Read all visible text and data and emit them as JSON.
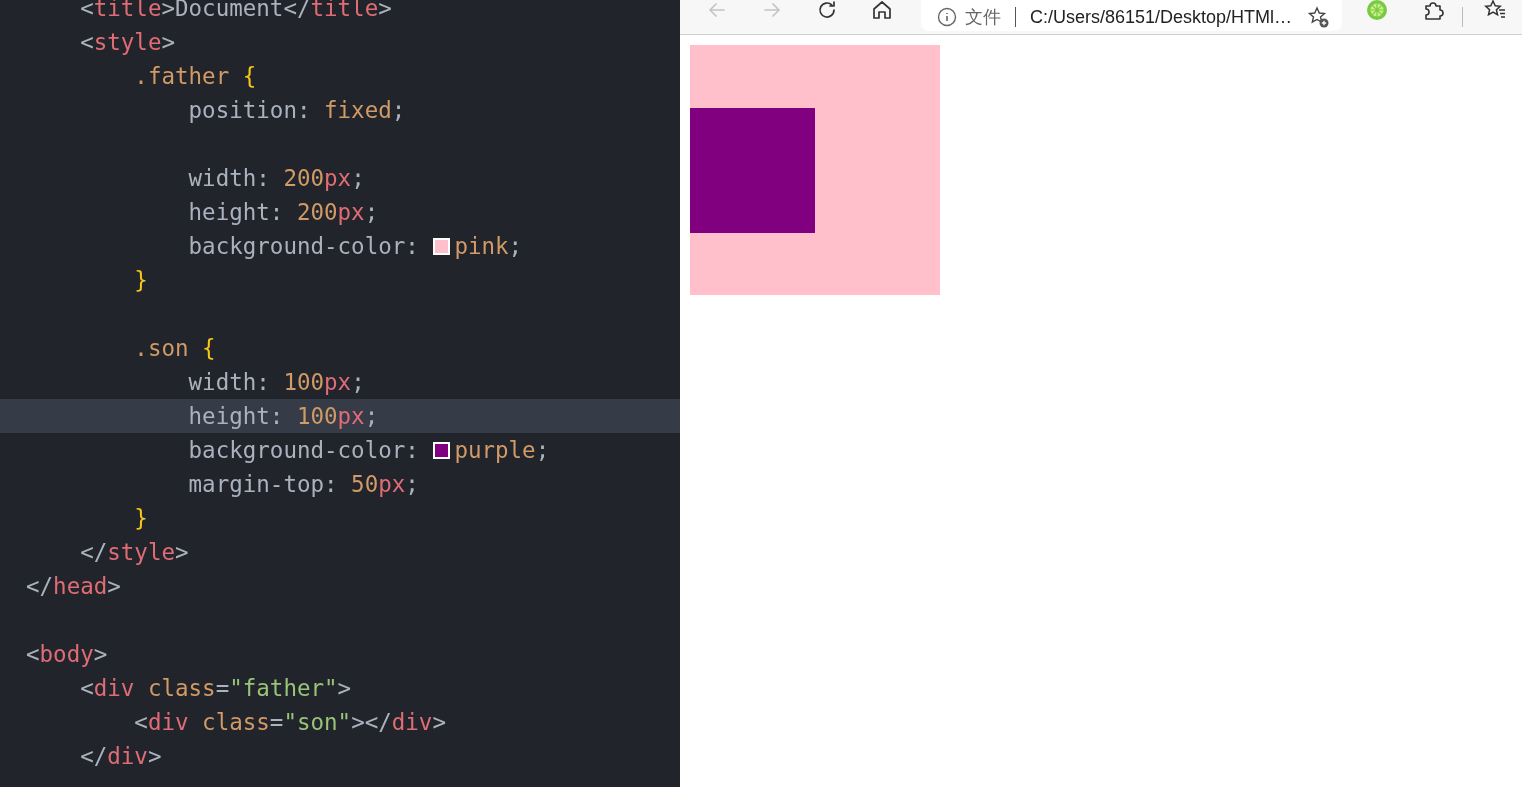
{
  "editor": {
    "lines": [
      {
        "current": false,
        "tokens": [
          {
            "kind": "punct",
            "text": "    <"
          },
          {
            "kind": "tag",
            "text": "title"
          },
          {
            "kind": "punct",
            "text": ">Document</"
          },
          {
            "kind": "tag",
            "text": "title"
          },
          {
            "kind": "punct",
            "text": ">"
          }
        ]
      },
      {
        "current": false,
        "tokens": [
          {
            "kind": "punct",
            "text": "    <"
          },
          {
            "kind": "tag",
            "text": "style"
          },
          {
            "kind": "punct",
            "text": ">"
          }
        ]
      },
      {
        "current": false,
        "tokens": [
          {
            "kind": "selector",
            "text": "        .father "
          },
          {
            "kind": "brace",
            "text": "{"
          }
        ]
      },
      {
        "current": false,
        "tokens": [
          {
            "kind": "prop",
            "text": "            position: "
          },
          {
            "kind": "number",
            "text": "fixed"
          },
          {
            "kind": "punct",
            "text": ";"
          }
        ]
      },
      {
        "current": false
      },
      {
        "current": false,
        "tokens": [
          {
            "kind": "prop",
            "text": "            width: "
          },
          {
            "kind": "number",
            "text": "200"
          },
          {
            "kind": "unit",
            "text": "px"
          },
          {
            "kind": "punct",
            "text": ";"
          }
        ]
      },
      {
        "current": false,
        "tokens": [
          {
            "kind": "prop",
            "text": "            height: "
          },
          {
            "kind": "number",
            "text": "200"
          },
          {
            "kind": "unit",
            "text": "px"
          },
          {
            "kind": "punct",
            "text": ";"
          }
        ]
      },
      {
        "current": false,
        "tokens": [
          {
            "kind": "prop",
            "text": "            background-color: "
          },
          {
            "kind": "swatch",
            "color": "#ffc0cb"
          },
          {
            "kind": "number",
            "text": "pink"
          },
          {
            "kind": "punct",
            "text": ";"
          }
        ]
      },
      {
        "current": false,
        "tokens": [
          {
            "kind": "brace",
            "text": "        }"
          }
        ]
      },
      {
        "current": false
      },
      {
        "current": false,
        "tokens": [
          {
            "kind": "selector",
            "text": "        .son "
          },
          {
            "kind": "brace",
            "text": "{"
          }
        ]
      },
      {
        "current": false,
        "tokens": [
          {
            "kind": "prop",
            "text": "            width: "
          },
          {
            "kind": "number",
            "text": "100"
          },
          {
            "kind": "unit",
            "text": "px"
          },
          {
            "kind": "punct",
            "text": ";"
          }
        ]
      },
      {
        "current": true,
        "tokens": [
          {
            "kind": "prop",
            "text": "            height: "
          },
          {
            "kind": "number",
            "text": "100"
          },
          {
            "kind": "unit",
            "text": "px"
          },
          {
            "kind": "punct",
            "text": ";"
          }
        ]
      },
      {
        "current": false,
        "tokens": [
          {
            "kind": "prop",
            "text": "            background-color: "
          },
          {
            "kind": "swatch",
            "color": "#800080"
          },
          {
            "kind": "number",
            "text": "purple"
          },
          {
            "kind": "punct",
            "text": ";"
          }
        ]
      },
      {
        "current": false,
        "tokens": [
          {
            "kind": "prop",
            "text": "            margin-top: "
          },
          {
            "kind": "number",
            "text": "50"
          },
          {
            "kind": "unit",
            "text": "px"
          },
          {
            "kind": "punct",
            "text": ";"
          }
        ]
      },
      {
        "current": false,
        "tokens": [
          {
            "kind": "brace",
            "text": "        }"
          }
        ]
      },
      {
        "current": false,
        "tokens": [
          {
            "kind": "punct",
            "text": "    </"
          },
          {
            "kind": "tag",
            "text": "style"
          },
          {
            "kind": "punct",
            "text": ">"
          }
        ]
      },
      {
        "current": false,
        "tokens": [
          {
            "kind": "punct",
            "text": "</"
          },
          {
            "kind": "tag",
            "text": "head"
          },
          {
            "kind": "punct",
            "text": ">"
          }
        ]
      },
      {
        "current": false
      },
      {
        "current": false,
        "tokens": [
          {
            "kind": "punct",
            "text": "<"
          },
          {
            "kind": "tag",
            "text": "body"
          },
          {
            "kind": "punct",
            "text": ">"
          }
        ]
      },
      {
        "current": false,
        "tokens": [
          {
            "kind": "punct",
            "text": "    <"
          },
          {
            "kind": "tag",
            "text": "div "
          },
          {
            "kind": "attr",
            "text": "class"
          },
          {
            "kind": "punct",
            "text": "="
          },
          {
            "kind": "string",
            "text": "\"father\""
          },
          {
            "kind": "punct",
            "text": ">"
          }
        ]
      },
      {
        "current": false,
        "tokens": [
          {
            "kind": "punct",
            "text": "        <"
          },
          {
            "kind": "tag",
            "text": "div "
          },
          {
            "kind": "attr",
            "text": "class"
          },
          {
            "kind": "punct",
            "text": "="
          },
          {
            "kind": "string",
            "text": "\"son\""
          },
          {
            "kind": "punct",
            "text": "></"
          },
          {
            "kind": "tag",
            "text": "div"
          },
          {
            "kind": "punct",
            "text": ">"
          }
        ]
      },
      {
        "current": false,
        "tokens": [
          {
            "kind": "punct",
            "text": "    </"
          },
          {
            "kind": "tag",
            "text": "div"
          },
          {
            "kind": "punct",
            "text": ">"
          }
        ]
      }
    ]
  },
  "browser": {
    "toolbar": [
      {
        "kind": "back",
        "disabled": true
      },
      {
        "kind": "forward",
        "disabled": true
      },
      {
        "kind": "refresh",
        "disabled": false
      },
      {
        "kind": "home",
        "disabled": false
      }
    ],
    "address_bar": {
      "scheme_label": "文件",
      "url": "C:/Users/86151/Desktop/HTMl…"
    },
    "page": {
      "boxes": [
        {
          "color": "#ffc0cb"
        },
        {
          "color": "#800080"
        }
      ]
    }
  }
}
